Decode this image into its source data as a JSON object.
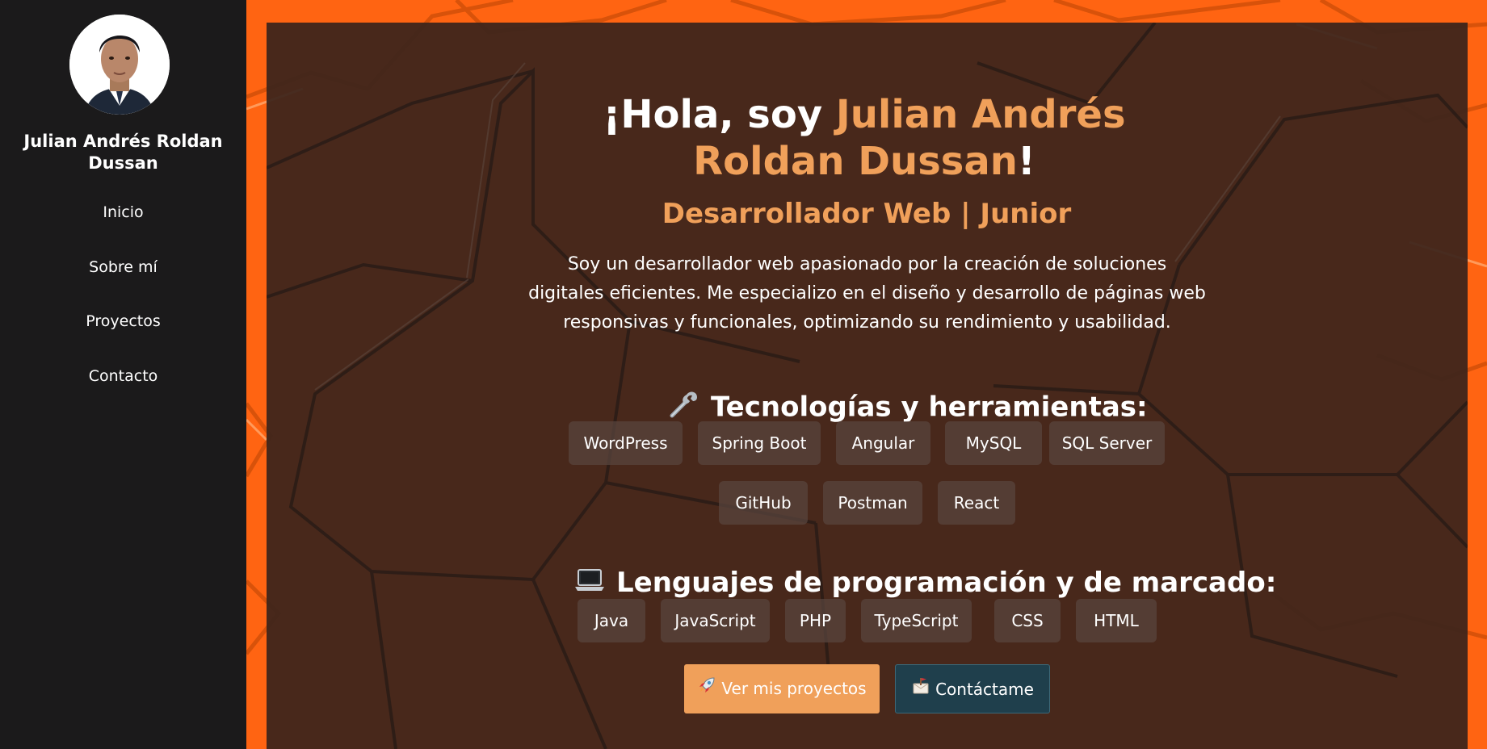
{
  "sidebar": {
    "name": "Julian Andrés Roldan Dussan",
    "nav": [
      {
        "label": "Inicio"
      },
      {
        "label": "Sobre mí"
      },
      {
        "label": "Proyectos"
      },
      {
        "label": "Contacto"
      }
    ]
  },
  "hero": {
    "greeting": "¡Hola, soy ",
    "name": "Julian Andrés Roldan Dussan",
    "exclamation": "!",
    "subtitle": "Desarrollador Web | Junior",
    "intro": "Soy un desarrollador web apasionado por la creación de soluciones digitales eficientes. Me especializo en el diseño y desarrollo de páginas web responsivas y funcionales, optimizando su rendimiento y usabilidad."
  },
  "tools": {
    "icon": "wrench-icon",
    "title": "Tecnologías y herramientas:",
    "items": [
      "WordPress",
      "Spring Boot",
      "Angular",
      "MySQL",
      "SQL Server",
      "GitHub",
      "Postman",
      "React"
    ]
  },
  "languages": {
    "icon": "laptop-icon",
    "title": "Lenguajes de programación y de marcado:",
    "items": [
      "Java",
      "JavaScript",
      "PHP",
      "TypeScript",
      "CSS",
      "HTML"
    ]
  },
  "actions": {
    "projects_label": "Ver mis proyectos",
    "projects_icon": "rocket-icon",
    "contact_label": "Contáctame",
    "contact_icon": "mailbox-icon"
  },
  "colors": {
    "accent": "#f0a05a",
    "orange_background": "#ff6412",
    "sidebar": "#1b1a1b",
    "contact_button": "#1f3f4c"
  }
}
